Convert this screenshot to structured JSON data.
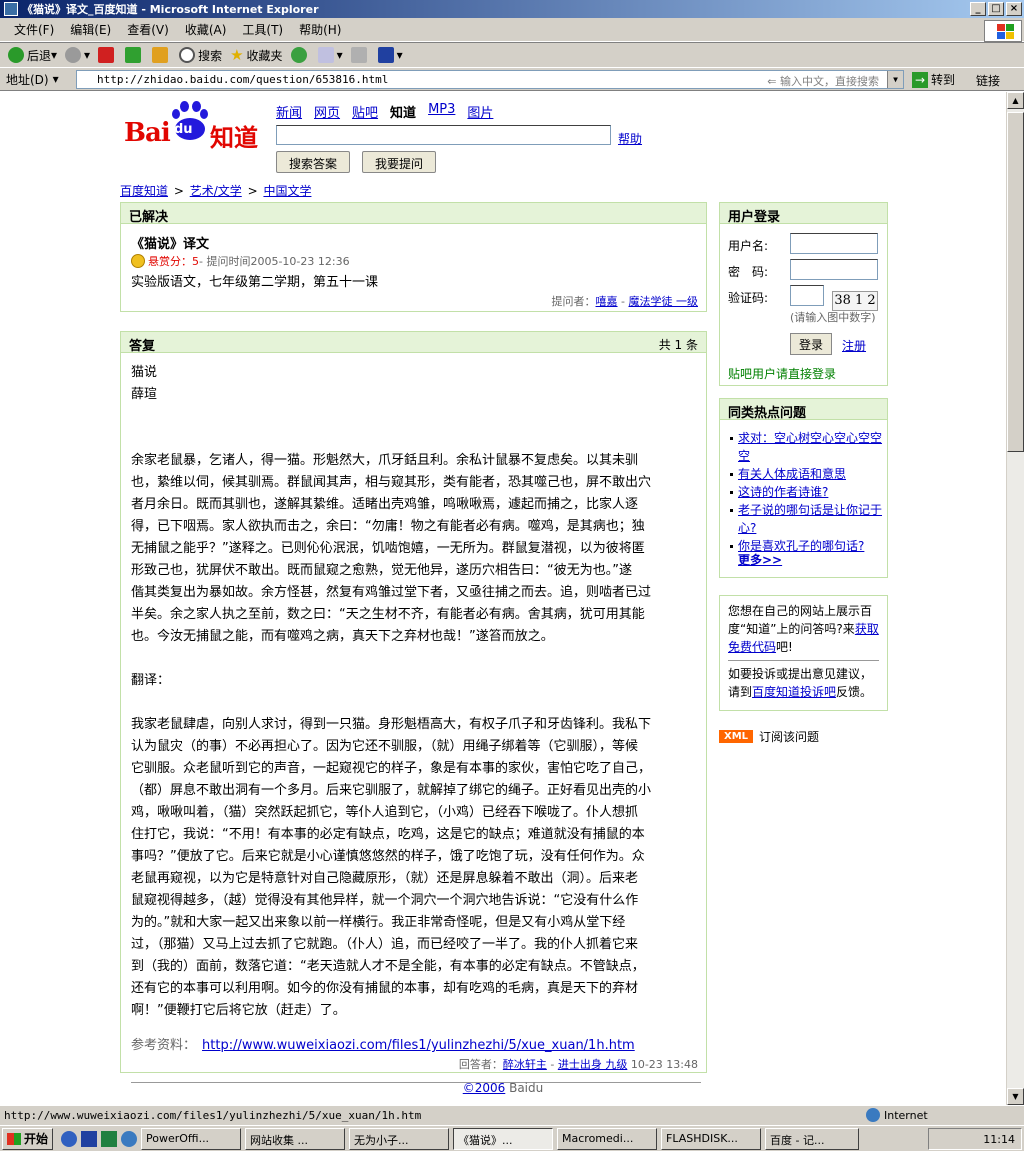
{
  "window": {
    "title": "《猫说》译文_百度知道 - Microsoft Internet Explorer",
    "menu": [
      "文件(F)",
      "编辑(E)",
      "查看(V)",
      "收藏(A)",
      "工具(T)",
      "帮助(H)"
    ],
    "toolbar": {
      "back": "后退",
      "search": "搜索",
      "favorites": "收藏夹"
    },
    "address_label": "地址(D)",
    "url": "http://zhidao.baidu.com/question/653816.html",
    "address_hint": "输入中文，直接搜索",
    "goto": "转到",
    "links": "链接"
  },
  "header": {
    "logo_text": "Bai",
    "logo_du": "du",
    "logo_zhidao": "知道",
    "nav": [
      "新闻",
      "网页",
      "贴吧",
      "知道",
      "MP3",
      "图片"
    ],
    "help": "帮助",
    "btn_search": "搜索答案",
    "btn_ask": "我要提问"
  },
  "breadcrumb": [
    "百度知道",
    "艺术/文学",
    "中国文学"
  ],
  "question": {
    "status": "已解决",
    "title": "《猫说》译文",
    "reward_label": "悬赏分：",
    "reward": "5",
    "time": " - 提问时间2005-10-23 12:36",
    "body": "实验版语文，七年级第二学期，第五十一课",
    "asker_label": "提问者：",
    "asker": "嘻嘉",
    "asker_rank": "魔法学徒 一级"
  },
  "answer": {
    "header": "答复",
    "count": "共 1 条",
    "lines": [
      "猫说",
      "薛瑄",
      "",
      "",
      "余家老鼠暴，乞诸人，得一猫。形魁然大，爪牙銛且利。余私计鼠暴不复虑矣。以其未驯",
      "也，絷维以伺，候其驯焉。群鼠闻其声，相与窥其形，类有能者，恐其噬己也，屏不敢出穴",
      "者月余日。既而其驯也，遂解其絷维。适睹出壳鸡雏，鸣啾啾焉，遽起而捕之，比家人逐",
      "得，已下咽焉。家人欲执而击之，余曰：“勿庸！物之有能者必有病。噬鸡，是其病也；独",
      "无捕鼠之能乎？”遂释之。已则伈伈泯泯，饥啮饱嬉，一无所为。群鼠复潜视，以为彼将匿",
      "形致己也，犹屏伏不敢出。既而鼠窥之愈熟，觉无他异，遂历穴相告曰：“彼无为也。”遂",
      "偕其类复出为暴如故。余方怪甚，然复有鸡雏过堂下者，又亟往捕之而去。追，则啮者已过",
      "半矣。余之家人执之至前，数之曰：“天之生材不齐，有能者必有病。舍其病，犹可用其能",
      "也。今汝无捕鼠之能，而有噬鸡之病，真天下之弃材也哉！”遂笞而放之。",
      "",
      "翻译：",
      "",
      "我家老鼠肆虐，向别人求讨，得到一只猫。身形魁梧高大，有权子爪子和牙齿锋利。我私下",
      "认为鼠灾（的事）不必再担心了。因为它还不驯服，（就）用绳子绑着等（它驯服），等候",
      "它驯服。众老鼠听到它的声音，一起窥视它的样子，象是有本事的家伙，害怕它吃了自己，",
      "（都）屏息不敢出洞有一个多月。后来它驯服了，就解掉了绑它的绳子。正好看见出壳的小",
      "鸡，啾啾叫着，（猫）突然跃起抓它，等仆人追到它，（小鸡）已经吞下喉咙了。仆人想抓",
      "住打它，我说：“不用！有本事的必定有缺点，吃鸡，这是它的缺点；难道就没有捕鼠的本",
      "事吗？”便放了它。后来它就是小心谨慎悠悠然的样子，饿了吃饱了玩，没有任何作为。众",
      "老鼠再窥视，以为它是特意针对自己隐藏原形，（就）还是屏息躲着不敢出（洞）。后来老",
      "鼠窥视得越多，（越）觉得没有其他异样，就一个洞穴一个洞穴地告诉说：“它没有什么作",
      "为的。”就和大家一起又出来象以前一样横行。我正非常奇怪呢，但是又有小鸡从堂下经",
      "过，（那猫）又马上过去抓了它就跑。（仆人）追，而已经咬了一半了。我的仆人抓着它来",
      "到（我的）面前，数落它道：“老天造就人才不是全能，有本事的必定有缺点。不管缺点，",
      "还有它的本事可以利用啊。如今的你没有捕鼠的本事，却有吃鸡的毛病，真是天下的弃材",
      "啊！”便鞭打它后将它放（赶走）了。"
    ],
    "ref_label": "参考资料：",
    "ref_url": "http://www.wuweixiaozi.com/files1/yulinzhezhi/5/xue_xuan/1h.htm",
    "answerer_label": "回答者：",
    "answerer": "醉冰轩主",
    "answerer_rank": "进士出身 九级",
    "answer_time": "10-23 13:48"
  },
  "login": {
    "title": "用户登录",
    "user_label": "用户名:",
    "pass_label": "密　码:",
    "code_label": "验证码:",
    "captcha": "38 1 2",
    "captcha_hint": "(请输入图中数字)",
    "login_btn": "登录",
    "register": "注册",
    "tieba_note": "贴吧用户请直接登录"
  },
  "hot": {
    "title": "同类热点问题",
    "items": [
      "求对：空心树空心空心空空空",
      "有关人体成语和意思",
      "这诗的作者诗谁?",
      "老子说的哪句话是让你记于心?",
      "你是喜欢孔子的哪句话?"
    ],
    "more": "更多>>"
  },
  "promo": {
    "line1": "您想在自己的网站上展示百度“知道”上的问答吗?来",
    "link1": "获取免费代码",
    "line1_end": "吧!",
    "line2": "如要投诉或提出意见建议，请到",
    "link2": "百度知道投诉吧",
    "line2_end": "反馈。"
  },
  "rss": {
    "badge": "XML",
    "label": "订阅该问题"
  },
  "footer": {
    "copy": "©2006",
    "brand": " Baidu"
  },
  "statusbar": {
    "url": "http://www.wuweixiaozi.com/files1/yulinzhezhi/5/xue_xuan/1h.htm",
    "zone": "Internet"
  },
  "taskbar": {
    "start": "开始",
    "tasks": [
      "PowerOffi...",
      "网站收集 ...",
      "无为小子...",
      "《猫说》...",
      "Macromedi...",
      "FLASHDISK...",
      "百度 - 记..."
    ],
    "clock": "11:14"
  },
  "colors": {
    "accent_green": "#e5f3d8",
    "border_green": "#c2e0a8",
    "brand_red": "#e10601",
    "brand_blue": "#2319dc"
  }
}
